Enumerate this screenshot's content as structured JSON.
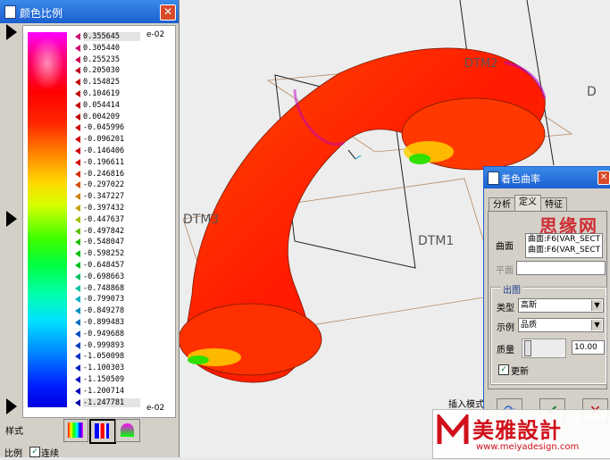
{
  "scale_window": {
    "title": "颜色比例",
    "exponent_top": "e-02",
    "exponent_bottom": "e-02",
    "values": [
      "0.355645",
      "0.305440",
      "0.255235",
      "0.205030",
      "0.154825",
      "0.104619",
      "0.054414",
      "0.004209",
      "-0.045996",
      "-0.096201",
      "-0.146406",
      "-0.196611",
      "-0.246816",
      "-0.297022",
      "-0.347227",
      "-0.397432",
      "-0.447637",
      "-0.497842",
      "-0.548047",
      "-0.598252",
      "-0.648457",
      "-0.698663",
      "-0.748868",
      "-0.799073",
      "-0.849278",
      "-0.899483",
      "-0.949688",
      "-0.999893",
      "-1.050098",
      "-1.100303",
      "-1.150509",
      "-1.200714",
      "-1.247781"
    ],
    "style_label": "样式",
    "ratio_label": "比例",
    "continuous_label": "连续",
    "continuous_checked": true
  },
  "viewport": {
    "datum_labels": [
      "DTM2",
      "DTM3",
      "DTM1",
      "D"
    ],
    "insert_mode_label": "插入模式"
  },
  "curvature_dialog": {
    "title": "着色曲率",
    "tabs": [
      "分析",
      "定义",
      "特征"
    ],
    "active_tab": "定义",
    "surface_label": "曲面",
    "surface_items": [
      "曲面:F6(VAR_SECT",
      "曲面:F6(VAR_SECT"
    ],
    "plane_label": "平面",
    "output_header": "出图",
    "type_label": "类型",
    "type_value": "高斯",
    "display_label": "示例",
    "display_value": "品质",
    "quality_label": "质量",
    "quality_value": "10.00",
    "update_label": "更新",
    "update_checked": true
  },
  "watermark": {
    "top_text": "思缘网",
    "brand_text": "美雅設計",
    "url": "www.meiyadesign.com"
  },
  "colors": {
    "title_blue": "#1b5fd0",
    "surface_red": "#ff2a00",
    "brand_red": "#d0101a"
  }
}
